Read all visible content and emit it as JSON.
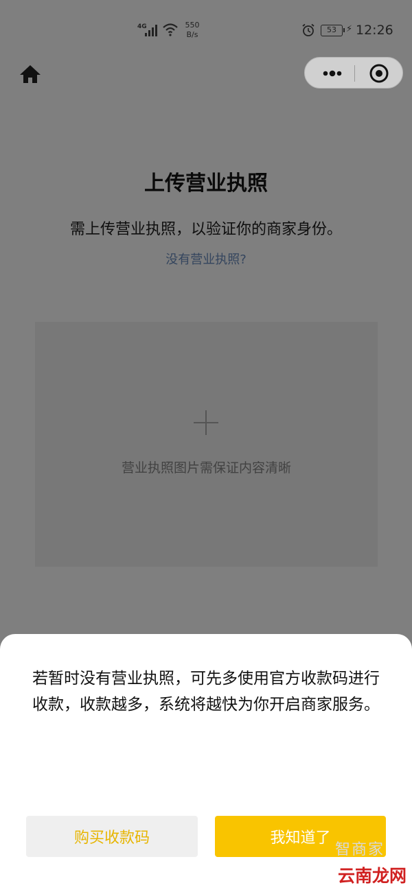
{
  "status_bar": {
    "network": "4G",
    "speed_value": "550",
    "speed_unit": "B/s",
    "battery": "53",
    "time": "12:26"
  },
  "nav": {
    "home_icon": "home-icon",
    "more_icon": "more-icon",
    "close_icon": "close-circle-icon"
  },
  "main": {
    "title": "上传营业执照",
    "subtitle": "需上传营业执照，以验证你的商家身份。",
    "no_license_link": "没有营业执照?",
    "upload": {
      "icon": "plus-icon",
      "hint": "营业执照图片需保证内容清晰"
    }
  },
  "sheet": {
    "message": "若暂时没有营业执照，可先多使用官方收款码进行收款，收款越多，系统将越快为你开启商家服务。",
    "buy_button": "购买收款码",
    "ok_button": "我知道了"
  },
  "watermark": {
    "top": "智商家",
    "text": "云南龙网"
  },
  "colors": {
    "overlay_bg": "#7f7f7f",
    "accent": "#f9c400",
    "link": "#34455e"
  }
}
